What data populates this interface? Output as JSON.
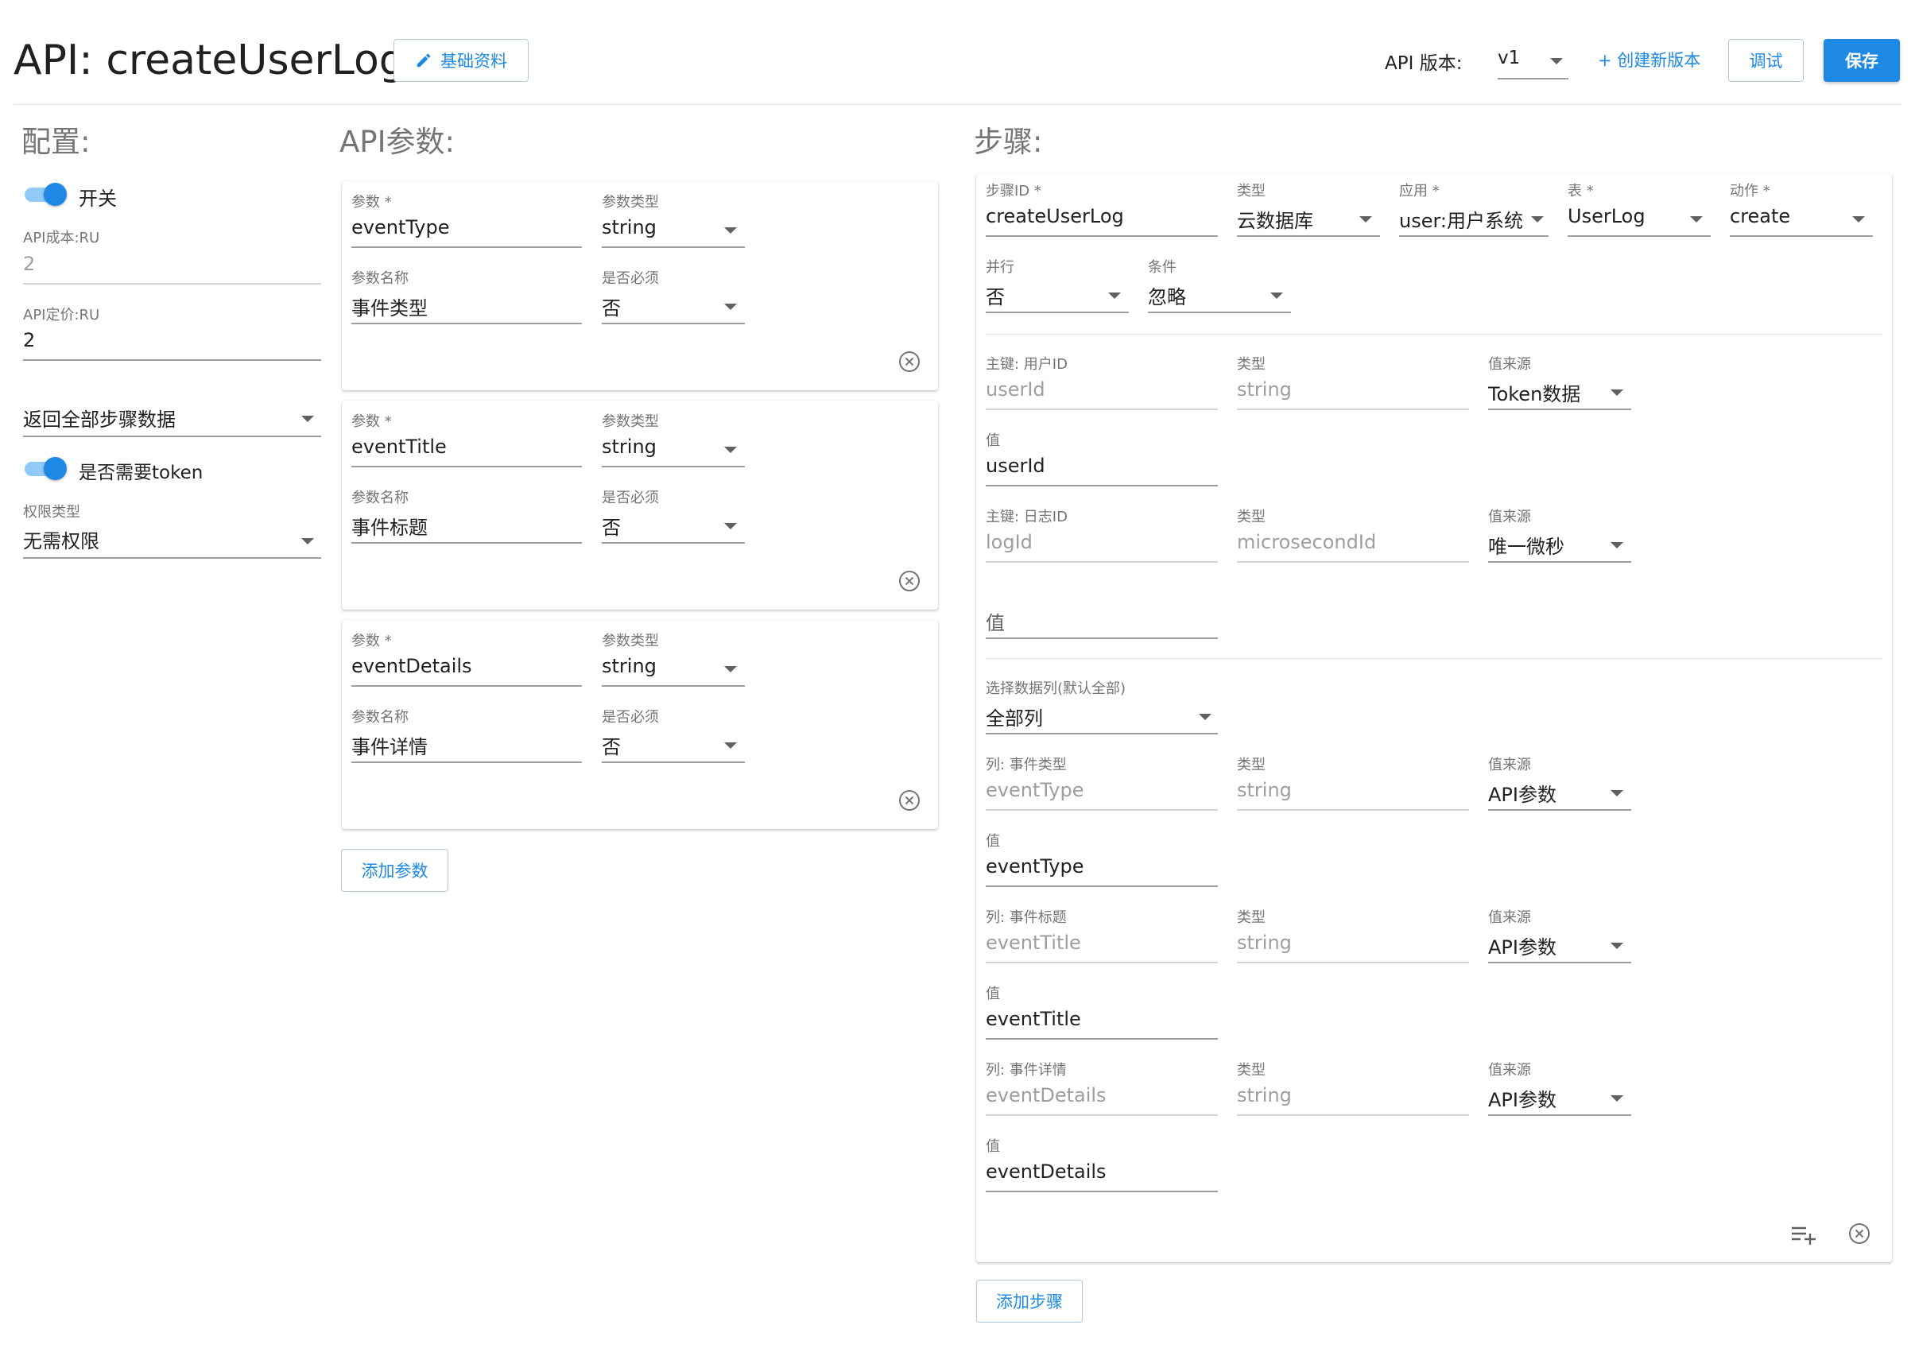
{
  "header": {
    "title": "API: createUserLog",
    "basic_info_label": "基础资料",
    "version_label": "API 版本:",
    "version_value": "v1",
    "create_version_label": "+ 创建新版本",
    "debug_label": "调试",
    "save_label": "保存"
  },
  "config": {
    "section_title": "配置:",
    "switch_label": "开关",
    "cost_label": "API成本:RU",
    "cost_value": "2",
    "price_label": "API定价:RU",
    "price_value": "2",
    "return_select": "返回全部步骤数据",
    "token_label": "是否需要token",
    "perm_label": "权限类型",
    "perm_value": "无需权限"
  },
  "params": {
    "section_title": "API参数:",
    "param_label": "参数",
    "type_label": "参数类型",
    "name_label": "参数名称",
    "required_label": "是否必须",
    "items": [
      {
        "param": "eventType",
        "type": "string",
        "name": "事件类型",
        "required": "否"
      },
      {
        "param": "eventTitle",
        "type": "string",
        "name": "事件标题",
        "required": "否"
      },
      {
        "param": "eventDetails",
        "type": "string",
        "name": "事件详情",
        "required": "否"
      }
    ],
    "add_label": "添加参数"
  },
  "steps": {
    "section_title": "步骤:",
    "step_id_label": "步骤ID",
    "step_id_value": "createUserLog",
    "type_label": "类型",
    "type_value": "云数据库",
    "app_label": "应用",
    "app_value": "user:用户系统",
    "table_label": "表",
    "table_value": "UserLog",
    "action_label": "动作",
    "action_value": "create",
    "parallel_label": "并行",
    "parallel_value": "否",
    "condition_label": "条件",
    "condition_value": "忽略",
    "source_label": "值来源",
    "value_label": "值",
    "pk_user_label": "主键: 用户ID",
    "pk_user_value": "userId",
    "pk_user_type": "string",
    "pk_user_source": "Token数据",
    "pk_user_val": "userId",
    "pk_log_label": "主键: 日志ID",
    "pk_log_value": "logId",
    "pk_log_type": "microsecondId",
    "pk_log_source": "唯一微秒",
    "pk_log_val_placeholder": "值",
    "cols_label": "选择数据列(默认全部)",
    "cols_value": "全部列",
    "columns": [
      {
        "label": "列: 事件类型",
        "name": "eventType",
        "type": "string",
        "source": "API参数",
        "value": "eventType"
      },
      {
        "label": "列: 事件标题",
        "name": "eventTitle",
        "type": "string",
        "source": "API参数",
        "value": "eventTitle"
      },
      {
        "label": "列: 事件详情",
        "name": "eventDetails",
        "type": "string",
        "source": "API参数",
        "value": "eventDetails"
      }
    ],
    "add_label": "添加步骤"
  },
  "colors": {
    "primary": "#1e88e5",
    "toggle_track": "#90caf9"
  }
}
